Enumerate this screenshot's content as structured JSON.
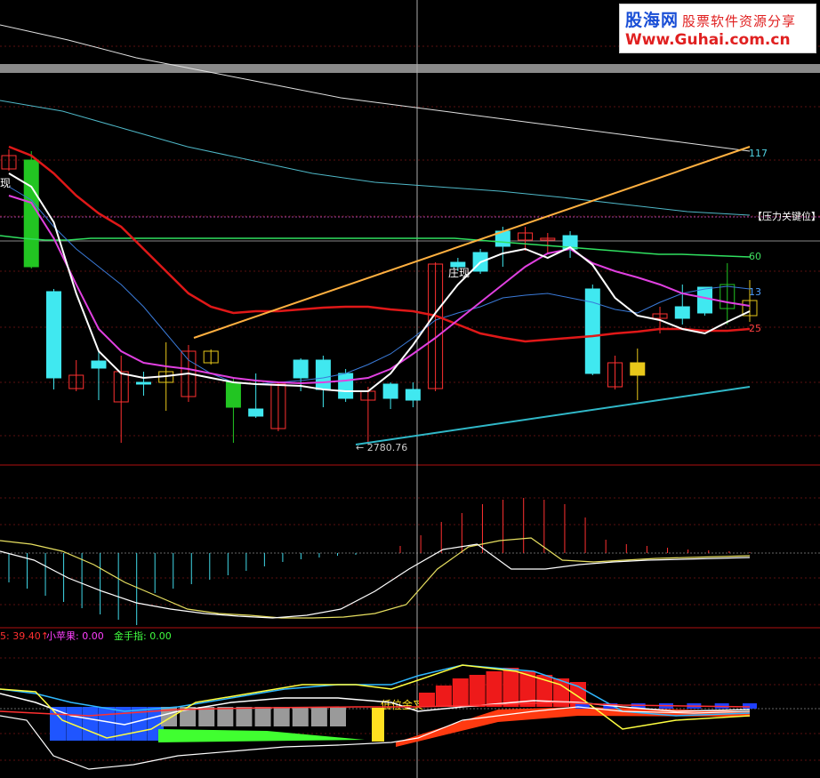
{
  "chart_data": [
    {
      "type": "candlestick",
      "panel": "main",
      "candles": [
        {
          "o": 190,
          "c": 175,
          "h": 168,
          "l": 192
        },
        {
          "o": 180,
          "c": 300,
          "h": 170,
          "l": 302
        },
        {
          "o": 328,
          "c": 425,
          "h": 325,
          "l": 438
        },
        {
          "o": 437,
          "c": 422,
          "h": 405,
          "l": 440
        },
        {
          "o": 406,
          "c": 414,
          "h": 395,
          "l": 450
        },
        {
          "o": 452,
          "c": 418,
          "h": 400,
          "l": 498
        },
        {
          "o": 430,
          "c": 430,
          "h": 418,
          "l": 445
        },
        {
          "o": 430,
          "c": 418,
          "h": 385,
          "l": 462
        },
        {
          "o": 446,
          "c": 395,
          "h": 388,
          "l": 452
        },
        {
          "o": 408,
          "c": 395,
          "h": 393,
          "l": 410
        },
        {
          "o": 430,
          "c": 458,
          "h": 425,
          "l": 498
        },
        {
          "o": 460,
          "c": 468,
          "h": 420,
          "l": 470
        },
        {
          "o": 482,
          "c": 432,
          "h": 430,
          "l": 485
        },
        {
          "o": 405,
          "c": 425,
          "h": 403,
          "l": 440
        },
        {
          "o": 405,
          "c": 438,
          "h": 400,
          "l": 458
        },
        {
          "o": 420,
          "c": 448,
          "h": 415,
          "l": 452
        },
        {
          "o": 450,
          "c": 440,
          "h": 435,
          "l": 500
        },
        {
          "o": 432,
          "c": 448,
          "h": 430,
          "l": 460
        },
        {
          "o": 438,
          "c": 450,
          "h": 430,
          "l": 458
        },
        {
          "o": 437,
          "c": 297,
          "h": 295,
          "l": 440
        },
        {
          "o": 295,
          "c": 300,
          "h": 290,
          "l": 305
        },
        {
          "o": 284,
          "c": 305,
          "h": 280,
          "l": 308
        },
        {
          "o": 260,
          "c": 277,
          "h": 255,
          "l": 300
        },
        {
          "o": 270,
          "c": 262,
          "h": 255,
          "l": 282
        },
        {
          "o": 270,
          "c": 268,
          "h": 262,
          "l": 285
        },
        {
          "o": 265,
          "c": 280,
          "h": 260,
          "l": 290
        },
        {
          "o": 325,
          "c": 420,
          "h": 320,
          "l": 422
        },
        {
          "o": 435,
          "c": 408,
          "h": 400,
          "l": 438
        },
        {
          "o": 408,
          "c": 422,
          "h": 392,
          "l": 450
        },
        {
          "o": 358,
          "c": 353,
          "h": 345,
          "l": 375
        },
        {
          "o": 345,
          "c": 358,
          "h": 320,
          "l": 365
        },
        {
          "o": 323,
          "c": 352,
          "h": 325,
          "l": 355
        },
        {
          "o": 347,
          "c": 320,
          "h": 296,
          "l": 365
        },
        {
          "o": 355,
          "c": 338,
          "h": 315,
          "l": 362
        }
      ],
      "ma_white": [
        195,
        210,
        250,
        330,
        395,
        420,
        425,
        423,
        420,
        425,
        430,
        432,
        433,
        434,
        438,
        440,
        440,
        420,
        388,
        352,
        320,
        295,
        285,
        280,
        290,
        278,
        298,
        335,
        355,
        360,
        370,
        375,
        362,
        350
      ],
      "ma_magenta": [
        220,
        228,
        268,
        320,
        370,
        395,
        408,
        412,
        415,
        420,
        425,
        428,
        430,
        431,
        430,
        428,
        425,
        415,
        398,
        380,
        360,
        340,
        320,
        300,
        285,
        280,
        296,
        305,
        312,
        320,
        330,
        335,
        340,
        344
      ],
      "ma_blue": [
        210,
        225,
        255,
        280,
        300,
        320,
        345,
        375,
        405,
        420,
        430,
        432,
        430,
        428,
        425,
        420,
        410,
        398,
        380,
        360,
        352,
        345,
        335,
        332,
        330,
        335,
        340,
        348,
        352,
        340,
        330,
        325,
        322,
        325
      ],
      "ma_red": [
        165,
        175,
        195,
        220,
        240,
        255,
        280,
        305,
        330,
        345,
        352,
        350,
        350,
        348,
        346,
        345,
        345,
        348,
        350,
        355,
        365,
        375,
        380,
        384,
        382,
        380,
        378,
        375,
        373,
        370,
        370,
        372,
        372,
        370
      ],
      "ma_green": [
        265,
        268,
        270,
        270,
        268,
        268,
        268,
        268,
        268,
        268,
        268,
        268,
        268,
        268,
        268,
        268,
        268,
        268,
        268,
        268,
        268,
        270,
        272,
        274,
        276,
        278,
        280,
        282,
        284,
        286,
        286,
        287,
        288,
        289
      ],
      "ma_top_white": [
        28,
        45,
        65,
        80,
        95,
        110,
        120,
        130,
        140,
        150,
        160,
        170
      ],
      "ma_cyan": [
        113,
        125,
        145,
        165,
        180,
        195,
        205,
        210,
        215,
        222,
        230,
        238,
        242
      ],
      "trend_orange": [
        380,
        165
      ],
      "trend_teal": [
        500,
        435
      ],
      "right_labels": [
        "117",
        "【压力关键位】",
        "60",
        "13",
        "25"
      ],
      "annotations": [
        "现",
        "庄现"
      ],
      "low_label": "2780.76"
    },
    {
      "type": "bar",
      "panel": "indicator-1",
      "down_bars": [
        33,
        35,
        38,
        40,
        42,
        44,
        45,
        46,
        45,
        40,
        35,
        30,
        25,
        20,
        15,
        10,
        7,
        5,
        3,
        2
      ],
      "up_bars": [
        -8,
        -20,
        -35,
        -45,
        -55,
        -60,
        -62,
        -60,
        -55,
        -40,
        -15,
        -10,
        -8,
        -6,
        -4,
        -3,
        -2,
        -1
      ],
      "line_yellow": [
        608,
        612,
        620,
        635,
        655,
        670,
        685,
        690,
        692,
        695,
        695,
        694,
        690,
        680,
        640,
        615,
        608,
        605,
        630,
        632,
        630,
        628,
        627,
        626,
        625
      ],
      "line_white": [
        620,
        630,
        650,
        665,
        678,
        685,
        690,
        693,
        695,
        692,
        685,
        665,
        640,
        618,
        612,
        640,
        640,
        635,
        632,
        630,
        629,
        628,
        627
      ]
    },
    {
      "type": "bar",
      "panel": "indicator-2",
      "legend": [
        {
          "label": "5: 39.40↑",
          "color": "#ff3030"
        },
        {
          "label": "小苹果: 0.00",
          "color": "#ff40ff"
        },
        {
          "label": "金手指: 0.00",
          "color": "#40ff40"
        }
      ],
      "annotation": "低位金叉",
      "blue_bars": [
        6,
        7,
        6,
        7,
        6,
        7,
        6
      ],
      "gray_bars": [
        5,
        5,
        5,
        5,
        5,
        5,
        5,
        5,
        5,
        5
      ],
      "red_bars": [
        8,
        12,
        16,
        18,
        20,
        22,
        20,
        18,
        16,
        14
      ],
      "white_bars": [
        4,
        5,
        6,
        7,
        6,
        5,
        4
      ]
    }
  ],
  "watermark": {
    "line1": "股海网",
    "line1_sub": "股票软件资源分享",
    "line2": "Www.Guhai.com.cn"
  }
}
